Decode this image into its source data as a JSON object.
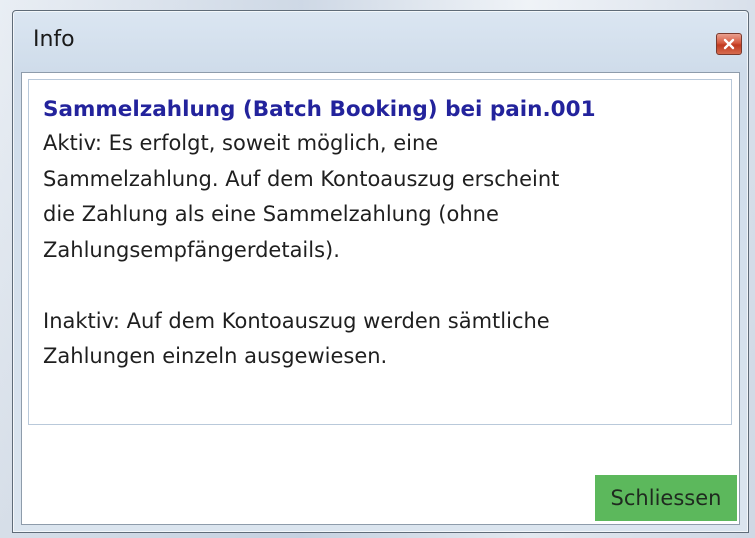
{
  "window": {
    "title": "Info"
  },
  "message": {
    "heading": "Sammelzahlung (Batch Booking) bei pain.001",
    "paragraph_active": "Aktiv: Es erfolgt, soweit möglich, eine\nSammelzahlung. Auf dem Kontoauszug erscheint\ndie Zahlung als eine Sammelzahlung (ohne\nZahlungsempfängerdetails).",
    "paragraph_inactive": "Inaktiv: Auf dem Kontoauszug werden sämtliche\nZahlungen einzeln ausgewiesen."
  },
  "footer": {
    "close_label": "Schliessen"
  },
  "icons": {
    "window_close": "close-icon"
  },
  "colors": {
    "heading": "#23239c",
    "close_button": "#5cb85c",
    "window_close": "#c0391f"
  }
}
